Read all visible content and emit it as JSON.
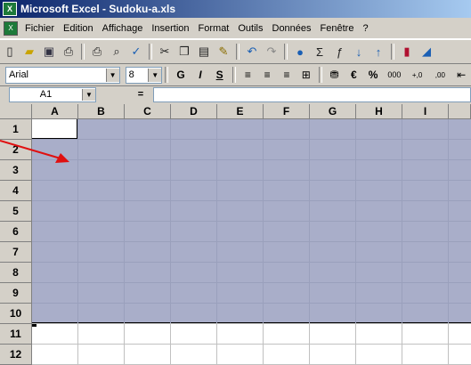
{
  "window": {
    "title": "Microsoft Excel - Sudoku-a.xls"
  },
  "menu": [
    "Fichier",
    "Edition",
    "Affichage",
    "Insertion",
    "Format",
    "Outils",
    "Données",
    "Fenêtre",
    "?"
  ],
  "format_bar": {
    "font": "Arial",
    "size": "8",
    "percent": "%",
    "thousands": "000",
    "inc_decimal": "+,0",
    "dec_decimal": ",00"
  },
  "formula_bar": {
    "name_box": "A1",
    "equals": "="
  },
  "columns": [
    "A",
    "B",
    "C",
    "D",
    "E",
    "F",
    "G",
    "H",
    "I"
  ],
  "rows": [
    "1",
    "2",
    "3",
    "4",
    "5",
    "6",
    "7",
    "8",
    "9",
    "10",
    "11",
    "12"
  ],
  "colors": {
    "selection": "#a9aec9",
    "title_start": "#0a246a",
    "arrow": "#e01010"
  }
}
